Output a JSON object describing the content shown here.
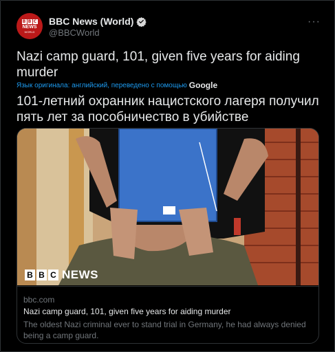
{
  "account": {
    "name": "BBC News (World)",
    "handle": "@BBCWorld",
    "avatar_letters": [
      "B",
      "B",
      "C"
    ],
    "avatar_news": "NEWS",
    "avatar_world": "WORLD"
  },
  "more_icon": "···",
  "tweet": {
    "text": "Nazi camp guard, 101, given five years for aiding murder",
    "translation_note": "Язык оригинала: английский, переведено с помощью",
    "translation_provider": "Google",
    "translated_text": "101-летний охранник нацистского лагеря получил пять лет за пособничество в убийстве"
  },
  "card": {
    "domain": "bbc.com",
    "title": "Nazi camp guard, 101, given five years for aiding murder",
    "description": "The oldest Nazi criminal ever to stand trial in Germany, he had always denied being a camp guard.",
    "image_logo": {
      "letters": [
        "B",
        "B",
        "C"
      ],
      "word": "NEWS"
    }
  },
  "colors": {
    "background": "#000000",
    "accent_link": "#1d9bf0",
    "secondary_text": "#71767b",
    "verified_badge": "#d9d9d9",
    "bbc_red": "#bb1919",
    "folder_blue": "#3b73c9"
  },
  "icons": [
    "verified-badge-icon",
    "more-options-icon"
  ]
}
